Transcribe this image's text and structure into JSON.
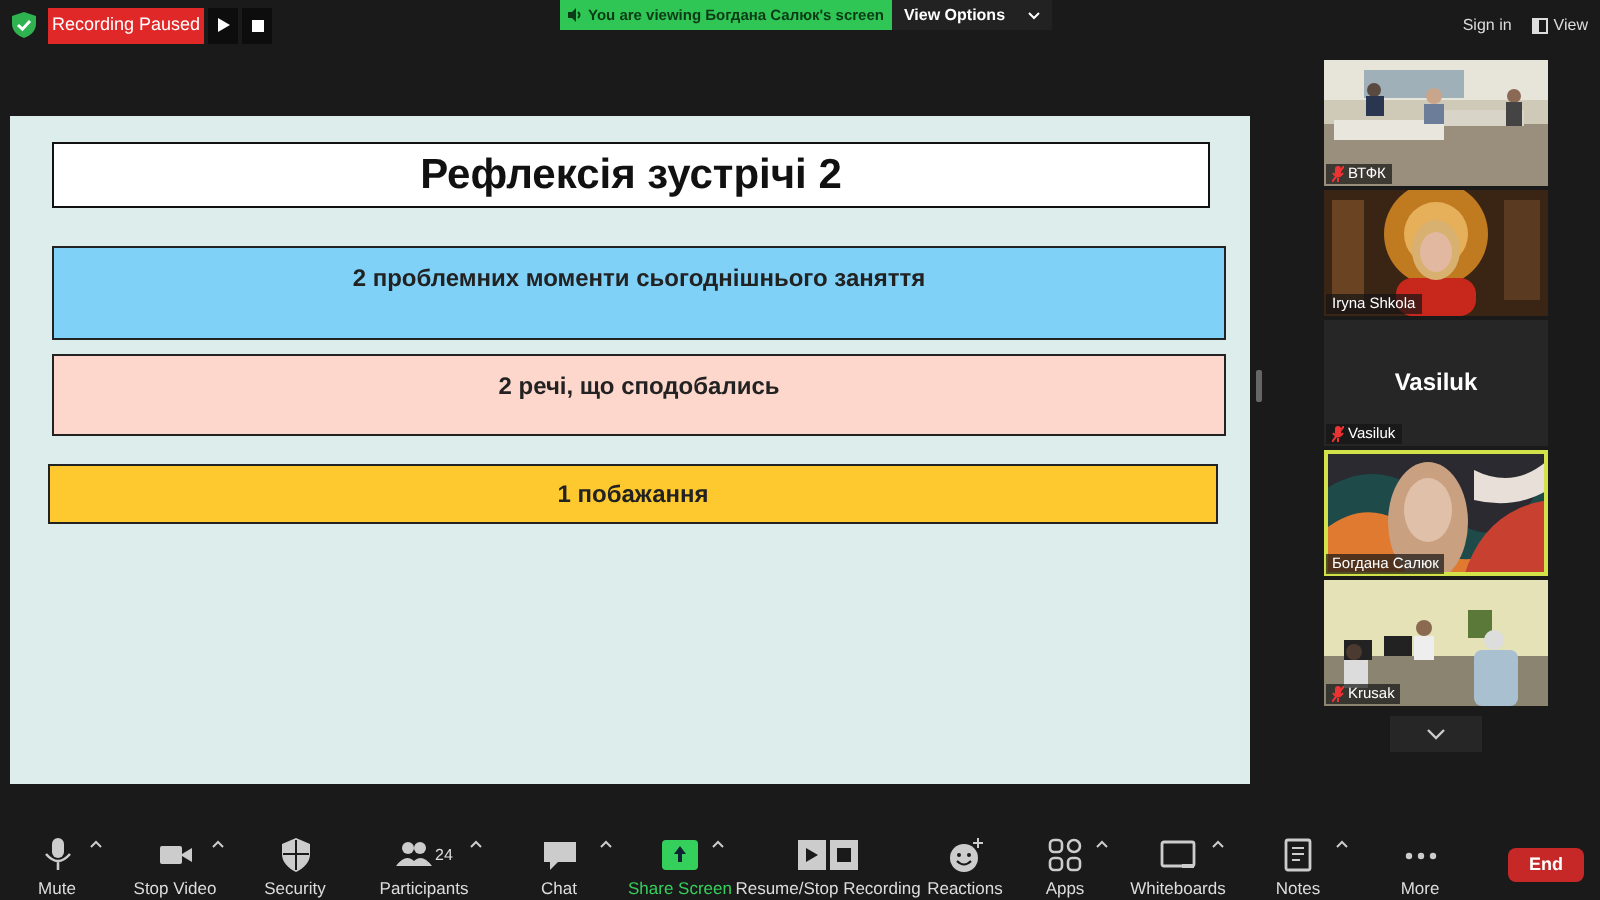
{
  "top_bar": {
    "recording_status": "Recording Paused",
    "viewing_banner": "You are viewing Богдана Салюк's screen",
    "view_options": "View Options",
    "sign_in": "Sign in",
    "view": "View"
  },
  "slide": {
    "title": "Рефлексія зустрічі 2",
    "boxes": [
      {
        "text": "2 проблемних моменти сьогоднішнього заняття",
        "color": "#7fd1f8"
      },
      {
        "text": "2 речі, що сподобались",
        "color": "#fdd7cc"
      },
      {
        "text": "1 побажання",
        "color": "#fdc92e"
      }
    ]
  },
  "participants": [
    {
      "name": "ВТФК",
      "kind": "video",
      "muted": true,
      "active": false
    },
    {
      "name": "Iryna Shkola",
      "kind": "video",
      "muted": false,
      "active": false
    },
    {
      "name": "Vasiluk",
      "kind": "name",
      "display_name": "Vasiluk",
      "muted": true,
      "active": false
    },
    {
      "name": "Богдана Салюк",
      "kind": "video",
      "muted": false,
      "active": true
    },
    {
      "name": "Krusak",
      "kind": "video",
      "muted": true,
      "active": false
    }
  ],
  "toolbar": [
    {
      "label": "Mute",
      "menu": true,
      "highlighted": false
    },
    {
      "label": "Stop Video",
      "menu": true,
      "highlighted": false
    },
    {
      "label": "Security",
      "menu": false,
      "highlighted": false
    },
    {
      "label": "Participants",
      "count": "24",
      "menu": true,
      "highlighted": false
    },
    {
      "label": "Chat",
      "menu": true,
      "highlighted": false
    },
    {
      "label": "Share Screen",
      "menu": true,
      "highlighted": true
    },
    {
      "label": "Resume/Stop Recording",
      "menu": false,
      "highlighted": false
    },
    {
      "label": "Reactions",
      "menu": false,
      "highlighted": false
    },
    {
      "label": "Apps",
      "menu": true,
      "highlighted": false
    },
    {
      "label": "Whiteboards",
      "menu": true,
      "highlighted": false
    },
    {
      "label": "Notes",
      "menu": true,
      "highlighted": false
    },
    {
      "label": "More",
      "menu": false,
      "highlighted": false
    }
  ],
  "end_button": "End"
}
